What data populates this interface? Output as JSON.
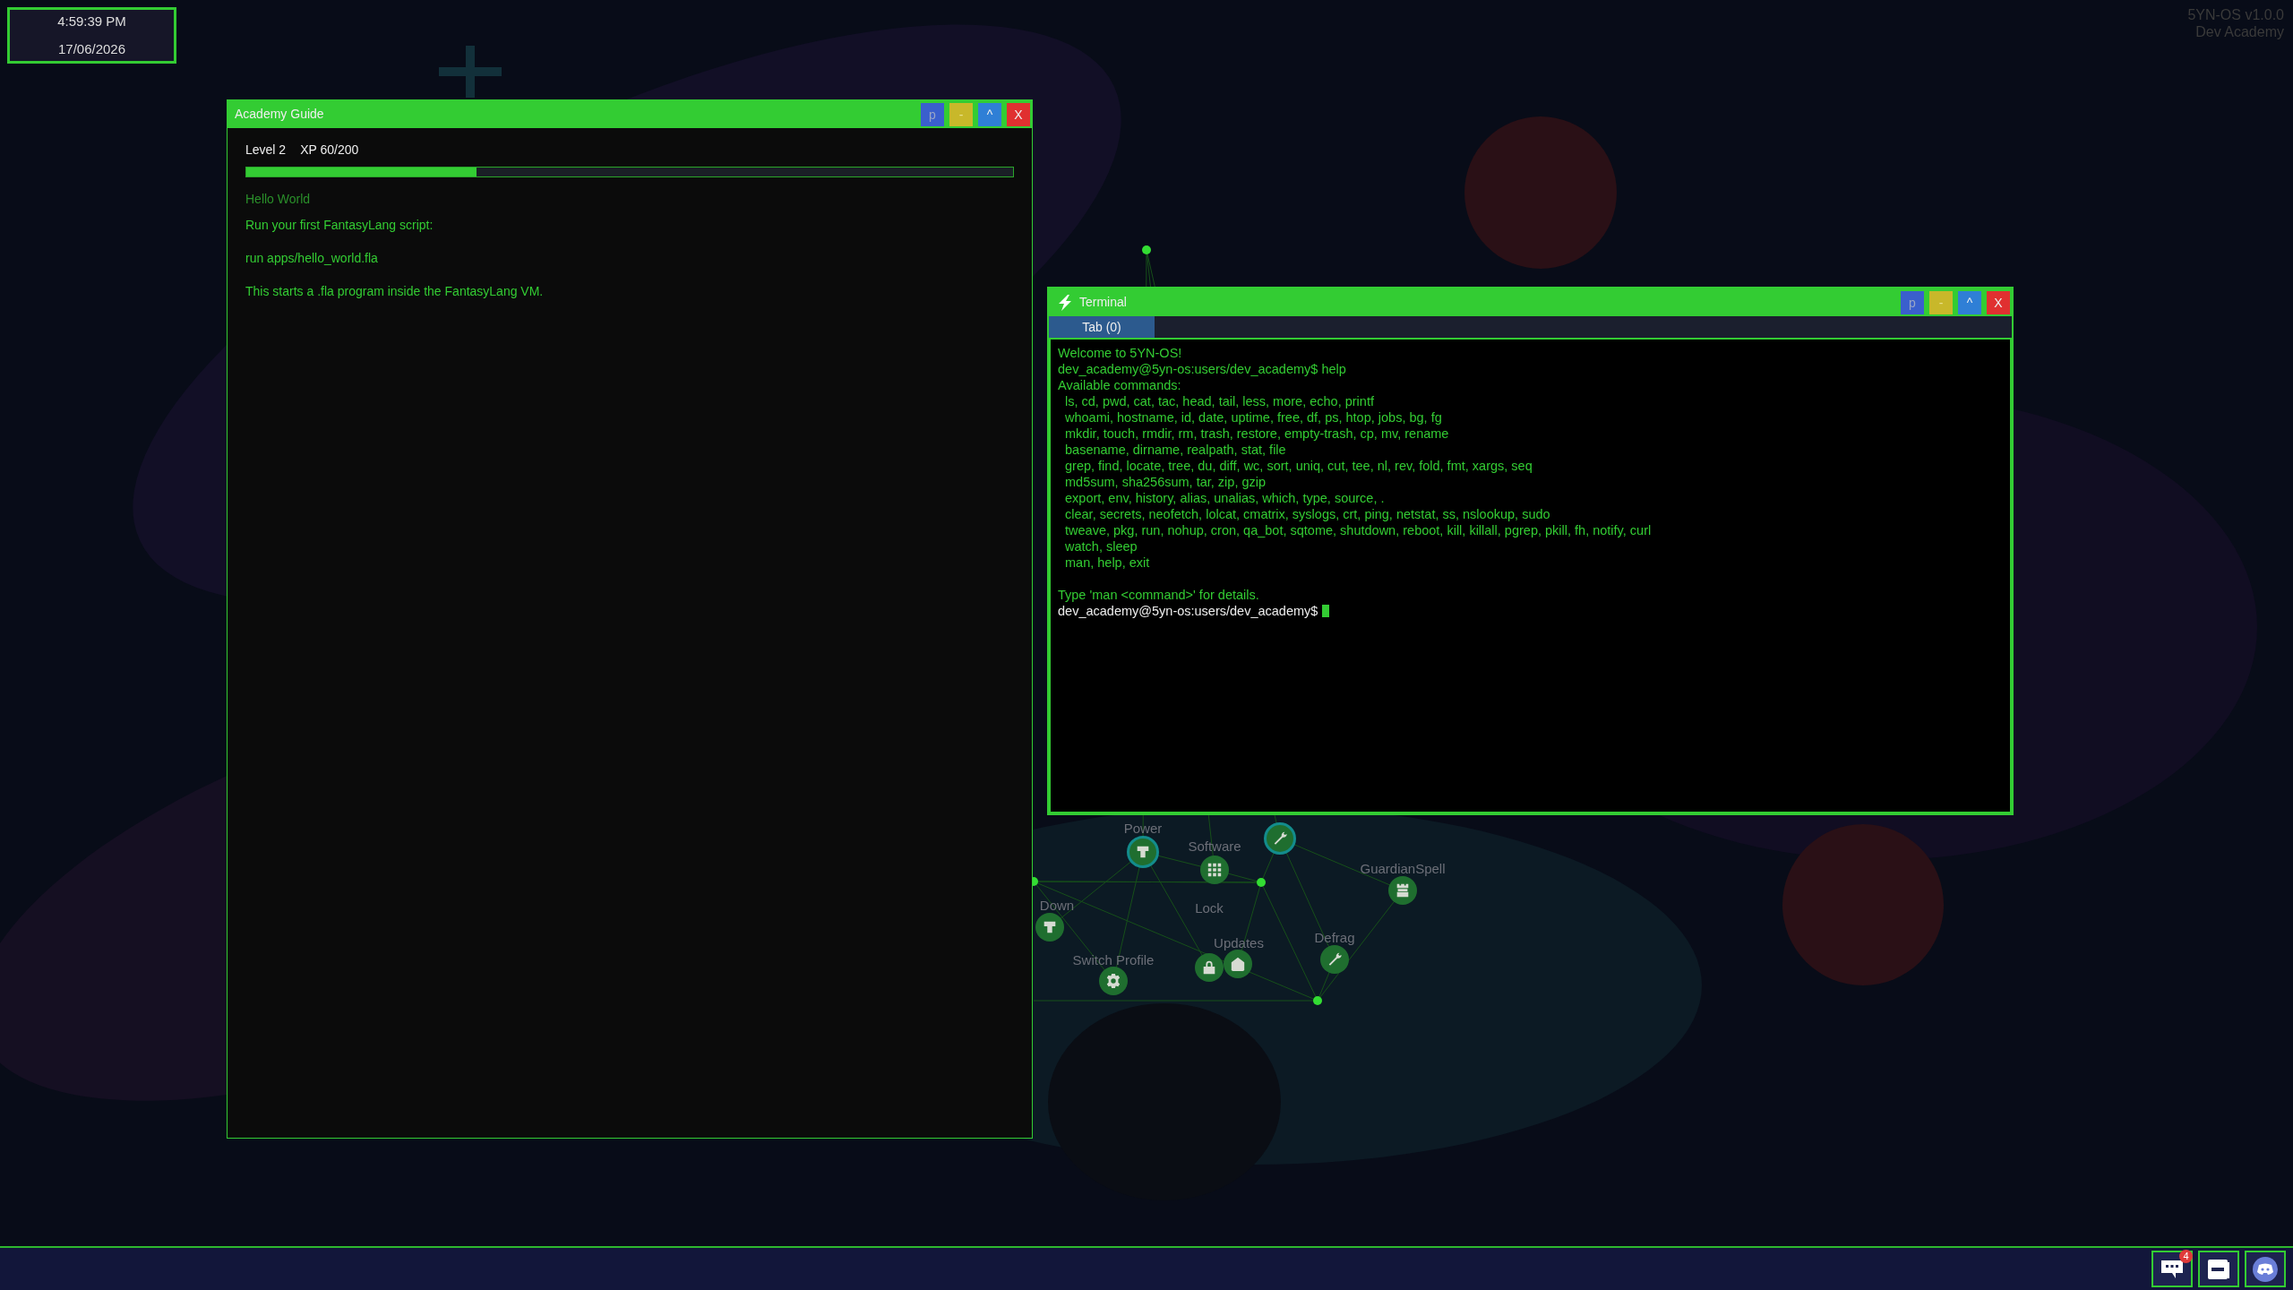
{
  "clock": {
    "time": "4:59:39 PM",
    "date": "17/06/2026"
  },
  "version": {
    "name": "5YN-OS v1.0.0",
    "edition": "Dev Academy"
  },
  "desktop_nodes": [
    {
      "label": "Power",
      "kind": "plug",
      "highlighted": true
    },
    {
      "label": "Software",
      "kind": "grid",
      "highlighted": false
    },
    {
      "kind": "wrench",
      "highlighted": true
    },
    {
      "label": "GuardianSpell",
      "kind": "tower",
      "highlighted": false
    },
    {
      "label": "Lock",
      "kind": "lock",
      "highlighted": false
    },
    {
      "label": "Updates",
      "kind": "house",
      "highlighted": false
    },
    {
      "label": "Defrag",
      "kind": "wrench",
      "highlighted": false
    },
    {
      "label": "Switch Profile",
      "kind": "gear",
      "highlighted": false
    },
    {
      "label": "Down",
      "kind": "plug",
      "highlighted": false
    }
  ],
  "guide_window": {
    "title": "Academy Guide",
    "buttons": [
      {
        "label": "p",
        "kind": "pin"
      },
      {
        "label": "-",
        "kind": "minimize"
      },
      {
        "label": "^",
        "kind": "maximize"
      },
      {
        "label": "X",
        "kind": "close"
      }
    ],
    "level_label": "Level 2",
    "xp_label": "XP 60/200",
    "xp_bar": {
      "level": 0.3
    },
    "lesson_title": "Hello World",
    "lines": [
      "Run your first FantasyLang script:",
      "run apps/hello_world.fla",
      "This starts a .fla program inside the FantasyLang VM."
    ]
  },
  "terminal_window": {
    "title": "Terminal",
    "buttons": [
      {
        "label": "p",
        "kind": "pin"
      },
      {
        "label": "-",
        "kind": "minimize"
      },
      {
        "label": "^",
        "kind": "maximize"
      },
      {
        "label": "X",
        "kind": "close"
      }
    ],
    "tabs": [
      {
        "label": "Tab (0)",
        "selected": true
      }
    ],
    "output": [
      {
        "kind": "line",
        "text": "Welcome to 5YN-OS!"
      },
      {
        "kind": "line",
        "text": "dev_academy@5yn-os:users/dev_academy$ help"
      },
      {
        "kind": "line",
        "text": "Available commands:"
      },
      {
        "kind": "item",
        "text": "ls, cd, pwd, cat, tac, head, tail, less, more, echo, printf"
      },
      {
        "kind": "item",
        "text": "whoami, hostname, id, date, uptime, free, df, ps, htop, jobs, bg, fg"
      },
      {
        "kind": "item",
        "text": "mkdir, touch, rmdir, rm, trash, restore, empty-trash, cp, mv, rename"
      },
      {
        "kind": "item",
        "text": "basename, dirname, realpath, stat, file"
      },
      {
        "kind": "item",
        "text": "grep, find, locate, tree, du, diff, wc, sort, uniq, cut, tee, nl, rev, fold, fmt, xargs, seq"
      },
      {
        "kind": "item",
        "text": "md5sum, sha256sum, tar, zip, gzip"
      },
      {
        "kind": "item",
        "text": "export, env, history, alias, unalias, which, type, source, ."
      },
      {
        "kind": "item",
        "text": "clear, secrets, neofetch, lolcat, cmatrix, syslogs, crt, ping, netstat, ss, nslookup, sudo"
      },
      {
        "kind": "item",
        "text": "tweave, pkg, run, nohup, cron, qa_bot, sqtome, shutdown, reboot, kill, killall, pgrep, pkill, fh, notify, curl"
      },
      {
        "kind": "item",
        "text": "watch, sleep"
      },
      {
        "kind": "item",
        "text": "man, help, exit"
      },
      {
        "kind": "blank"
      },
      {
        "kind": "line",
        "text": "Type 'man <command>' for details."
      },
      {
        "kind": "prompt",
        "text": "dev_academy@5yn-os:users/dev_academy$",
        "cursor": true
      }
    ]
  },
  "taskbar": [
    {
      "kind": "chat",
      "badge": "4"
    },
    {
      "kind": "window"
    },
    {
      "kind": "discord"
    }
  ]
}
